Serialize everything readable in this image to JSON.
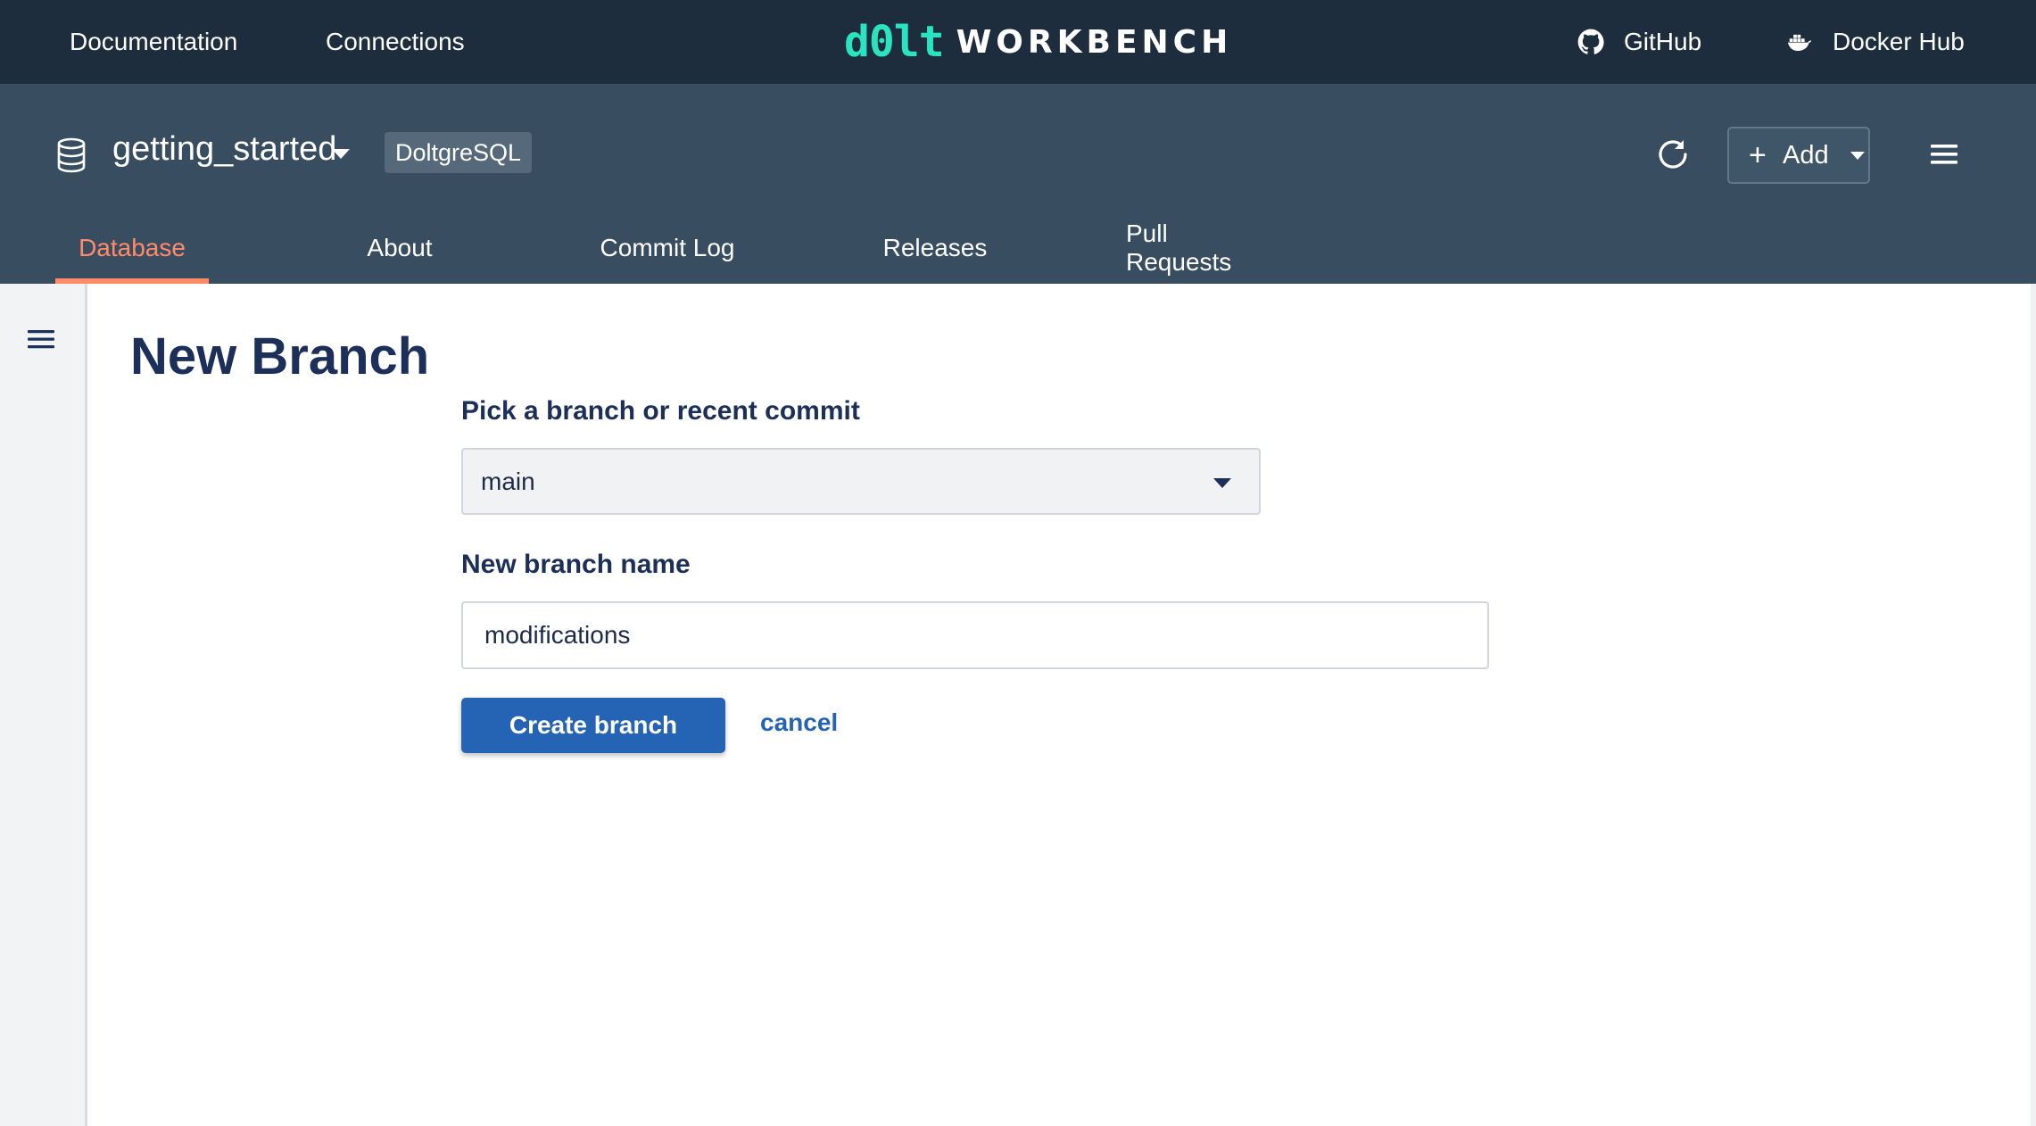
{
  "topnav": {
    "documentation": "Documentation",
    "connections": "Connections",
    "logo_dolt": "d0lt",
    "logo_workbench": "WORKBENCH",
    "github": "GitHub",
    "docker_hub": "Docker Hub",
    "github_icon": "github-icon",
    "docker_icon": "docker-icon"
  },
  "database": {
    "name": "getting_started",
    "badge": "DoltgreSQL",
    "icon": "database-icon"
  },
  "actions": {
    "add_label": "Add",
    "refresh_icon": "refresh-icon",
    "menu_icon": "hamburger-menu-icon"
  },
  "tabs": [
    {
      "label": "Database",
      "active": true
    },
    {
      "label": "About",
      "active": false
    },
    {
      "label": "Commit Log",
      "active": false
    },
    {
      "label": "Releases",
      "active": false
    },
    {
      "label": "Pull Requests",
      "active": false
    }
  ],
  "form": {
    "title": "New Branch",
    "pick_label": "Pick a branch or recent commit",
    "pick_value": "main",
    "name_label": "New branch name",
    "name_value": "modifications",
    "submit_label": "Create branch",
    "cancel_label": "cancel"
  },
  "colors": {
    "topnav_bg": "#1e2d3e",
    "header_bg": "#384d60",
    "accent": "#ff8b69",
    "logo": "#29e3c1",
    "primary": "#2563b5"
  }
}
